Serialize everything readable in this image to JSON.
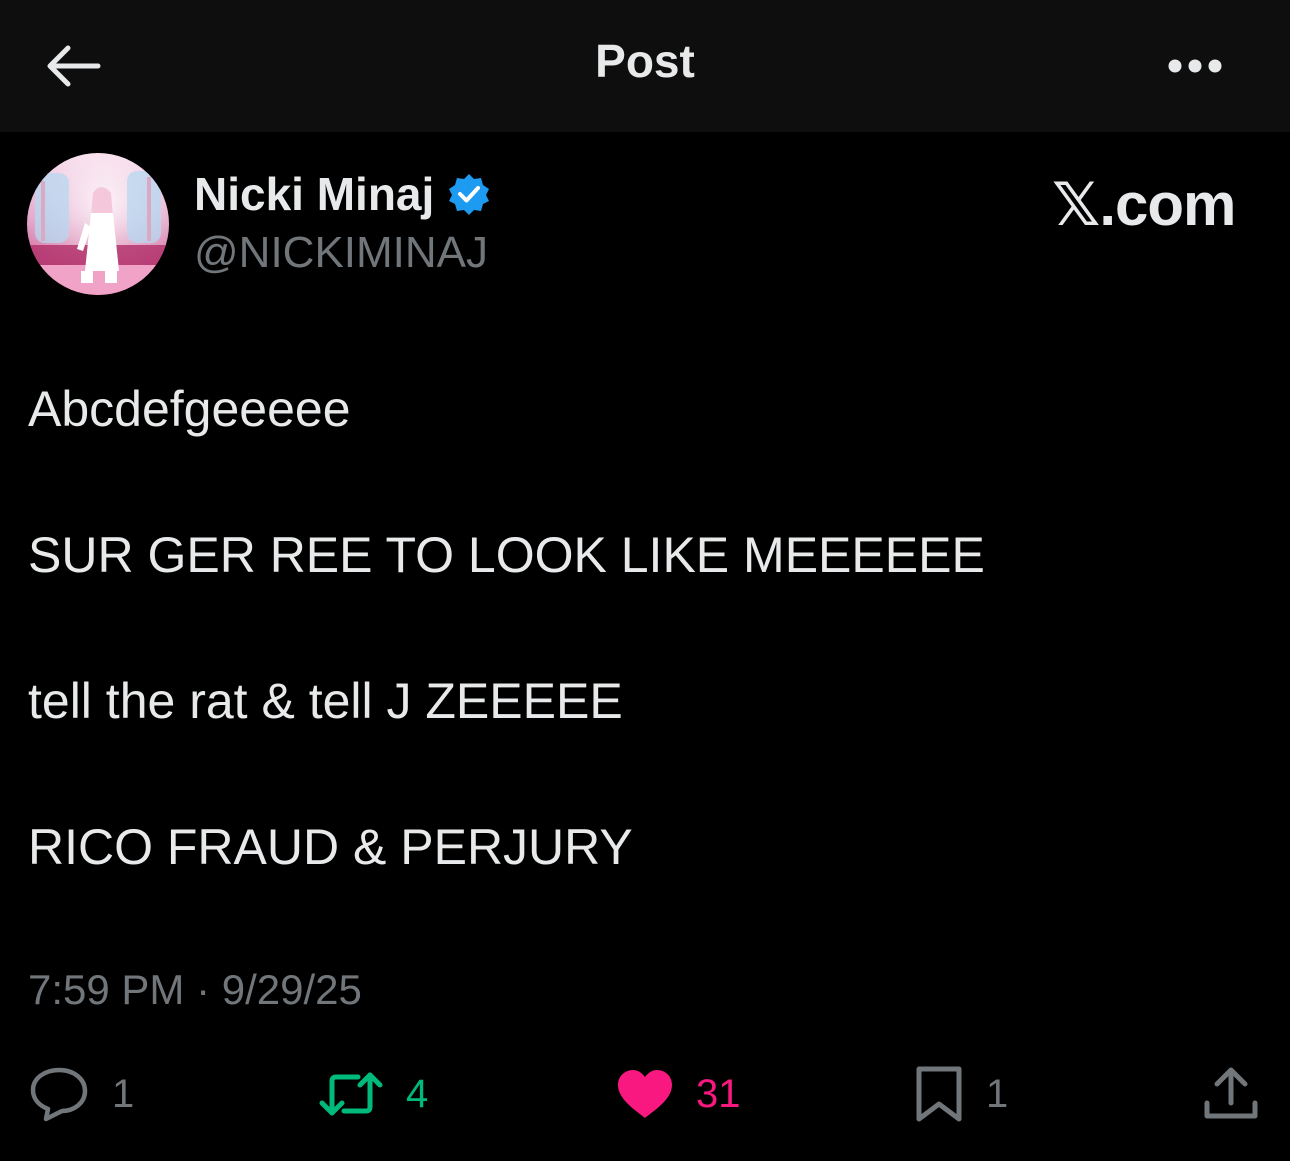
{
  "header": {
    "title": "Post",
    "back_icon": "arrow-left-icon",
    "more_icon": "more-horizontal-icon"
  },
  "author": {
    "display_name": "Nicki Minaj",
    "handle": "@NICKIMINAJ",
    "verified_icon": "verified-badge-icon",
    "verified_color": "#1d9bf0"
  },
  "watermark": {
    "x": "𝕏",
    "suffix": ".com"
  },
  "tweet": {
    "lines": [
      "Abcdefgeeeee",
      "SUR GER REE TO LOOK LIKE MEEEEEE",
      "tell the rat & tell J ZEEEEE",
      "RICO FRAUD & PERJURY"
    ],
    "timestamp": "7:59 PM · 9/29/25"
  },
  "actions": {
    "reply": {
      "count": "1",
      "icon": "reply-icon",
      "color": "#71767b"
    },
    "repost": {
      "count": "4",
      "icon": "repost-icon",
      "color": "#00ba7c"
    },
    "like": {
      "count": "31",
      "icon": "heart-filled-icon",
      "color": "#f91880"
    },
    "bookmark": {
      "count": "1",
      "icon": "bookmark-icon",
      "color": "#71767b"
    },
    "share": {
      "icon": "share-icon",
      "color": "#71767b"
    }
  },
  "colors": {
    "background": "#000000",
    "header_background": "#0e0e0e",
    "primary_text": "#e7e9ea",
    "secondary_text": "#71767b"
  }
}
